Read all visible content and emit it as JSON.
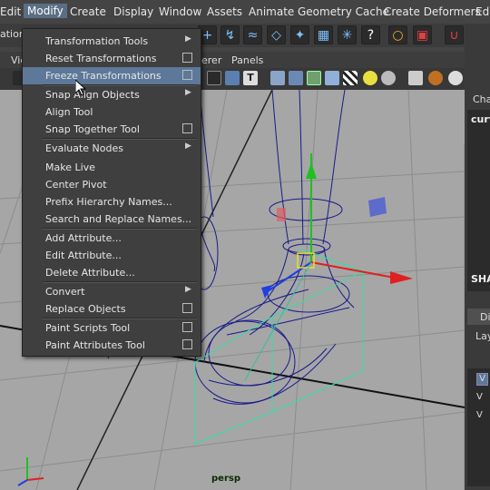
{
  "menubar": {
    "items": [
      "Edit",
      "Modify",
      "Create",
      "Display",
      "Window",
      "Assets",
      "Animate",
      "Geometry Cache",
      "Create Deformers",
      "Edi"
    ],
    "left_stub": "ation"
  },
  "panel_menu": {
    "view_stub": "Vie",
    "renderer_stub": "erer",
    "panels": "Panels"
  },
  "modify_menu": [
    {
      "label": "Transformation Tools",
      "type": "submenu"
    },
    {
      "label": "Reset Transformations",
      "type": "option"
    },
    {
      "label": "Freeze Transformations",
      "type": "option",
      "highlighted": true
    },
    {
      "label": "Snap Align Objects",
      "type": "submenu"
    },
    {
      "label": "Align Tool",
      "type": "plain"
    },
    {
      "label": "Snap Together Tool",
      "type": "option"
    },
    {
      "label": "Evaluate Nodes",
      "type": "submenu"
    },
    {
      "label": "Make Live",
      "type": "plain"
    },
    {
      "label": "Center Pivot",
      "type": "plain"
    },
    {
      "label": "Prefix Hierarchy Names...",
      "type": "plain"
    },
    {
      "label": "Search and Replace Names...",
      "type": "plain"
    },
    {
      "label": "Add Attribute...",
      "type": "plain"
    },
    {
      "label": "Edit Attribute...",
      "type": "plain"
    },
    {
      "label": "Delete Attribute...",
      "type": "plain"
    },
    {
      "label": "Convert",
      "type": "submenu"
    },
    {
      "label": "Replace Objects",
      "type": "option"
    },
    {
      "label": "Paint Scripts Tool",
      "type": "option"
    },
    {
      "label": "Paint Attributes Tool",
      "type": "option"
    }
  ],
  "viewport": {
    "camera_label": "persp"
  },
  "right_panel": {
    "cha": "Cha",
    "curv": "curv",
    "sha": "SHA",
    "dis": "Dis",
    "lay": "Lay",
    "v_rows": [
      "V",
      "V",
      "V"
    ]
  },
  "icons": {
    "shelf": [
      "move-icon",
      "curve-icon",
      "curve-tool-icon",
      "plane-icon",
      "bend-icon",
      "lattice-icon",
      "deform-icon",
      "help-icon",
      "lock-icon",
      "select-icon",
      "magnet-icon",
      "snap-icon"
    ],
    "panel": [
      "wireframe-icon",
      "shaded-icon",
      "texture-icon",
      "text-icon",
      "cube-icon",
      "xray-icon",
      "shaded-cube-icon",
      "checker-icon",
      "light-icon",
      "sphere-icon",
      "camera-icon",
      "ball-icon"
    ]
  },
  "colors": {
    "menu_highlight": "#5d7899",
    "menubar_active": "#5a6e85",
    "viewport_bg": "#a6a6a6"
  }
}
